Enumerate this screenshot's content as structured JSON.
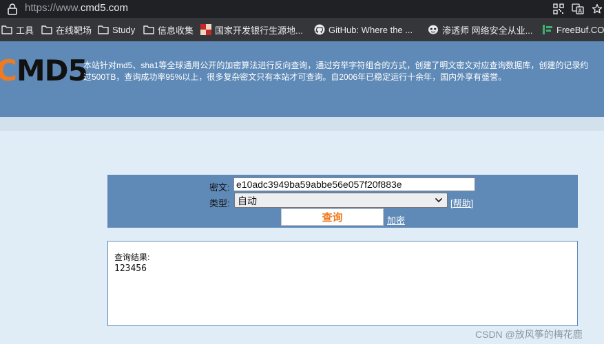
{
  "browser": {
    "url_prefix": "https://www.",
    "url_domain": "cmd5.com",
    "icons": {
      "lock": "lock-icon",
      "qr": "qr-code-icon",
      "translate": "translate-icon",
      "star": "star-icon"
    }
  },
  "bookmarks": [
    {
      "label": "工具",
      "icon": "folder-icon"
    },
    {
      "label": "在线靶场",
      "icon": "folder-icon"
    },
    {
      "label": "Study",
      "icon": "folder-icon"
    },
    {
      "label": "信息收集",
      "icon": "folder-icon"
    },
    {
      "label": "国家开发银行生源地...",
      "icon": "bank-favicon"
    },
    {
      "label": "GitHub: Where the ...",
      "icon": "github-icon"
    },
    {
      "label": "渗透师 网络安全从业...",
      "icon": "mask-favicon"
    },
    {
      "label": "FreeBuf.CO",
      "icon": "freebuf-favicon"
    }
  ],
  "site": {
    "logo_c": "C",
    "logo_rest": "MD5",
    "intro_line1": "本站针对md5、sha1等全球通用公开的加密算法进行反向查询，通过穷举字符组合的方式，创建了明文密文对应查询数据库，创建的记录约",
    "intro_line2": "过500TB，查询成功率95%以上，很多复杂密文只有本站才可查询。自2006年已稳定运行十余年，国内外享有盛誉。"
  },
  "form": {
    "cipher_label": "密文:",
    "cipher_value": "e10adc3949ba59abbe56e057f20f883e",
    "type_label": "类型:",
    "type_selected": "自动",
    "help_link": "[帮助]",
    "query_button": "查询",
    "encrypt_link": "加密"
  },
  "result": {
    "title": "查询结果:",
    "value": "123456"
  },
  "watermark": "CSDN @放风筝的梅花鹿",
  "colors": {
    "header_blue": "#5f8ab7",
    "accent_orange": "#f07a20",
    "page_bg": "#e1edf6"
  }
}
